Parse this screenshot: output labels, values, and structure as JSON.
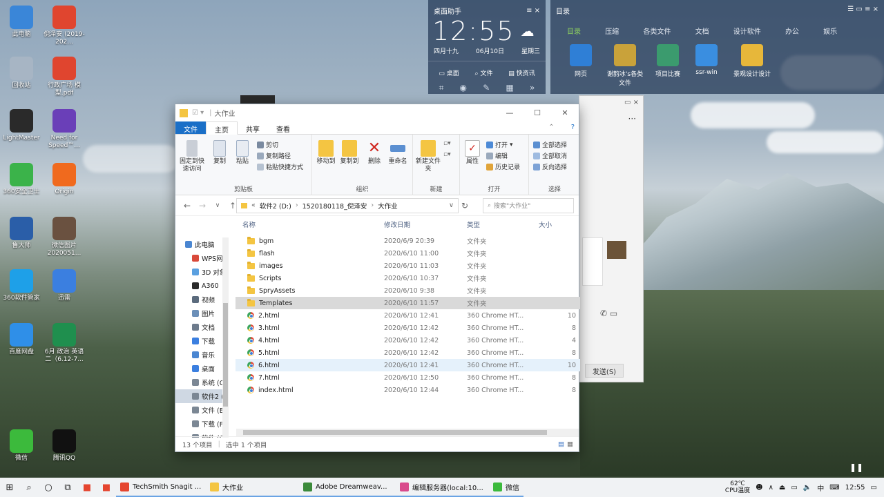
{
  "desktop_icons": [
    {
      "label": "此电脑",
      "icon": "computer-icon",
      "color": "#3a86d8"
    },
    {
      "label": "倪泽安 (2019-202...",
      "icon": "pdf-icon",
      "color": "#e0452f"
    },
    {
      "label": "回收站",
      "icon": "recycle-bin-icon",
      "color": "#a7b5c4"
    },
    {
      "label": "行政广场 模型.pdf",
      "icon": "pdf-icon",
      "color": "#e0452f"
    },
    {
      "label": "LightMaster",
      "icon": "lightmaster-icon",
      "color": "#2a2a2a"
    },
    {
      "label": "Need for Speed™...",
      "icon": "game-icon",
      "color": "#6a3fb8"
    },
    {
      "label": "360安全卫士",
      "icon": "360-security-icon",
      "color": "#3bb34a"
    },
    {
      "label": "Origin",
      "icon": "origin-icon",
      "color": "#f06a1e"
    },
    {
      "label": "鲁大师",
      "icon": "ludashi-icon",
      "color": "#2a5ea8"
    },
    {
      "label": "微信图片 2020051...",
      "icon": "image-icon",
      "color": "#6a5140"
    },
    {
      "label": "360软件管家",
      "icon": "360-software-icon",
      "color": "#1ea0e8"
    },
    {
      "label": "迅雷",
      "icon": "thunder-icon",
      "color": "#3b7fe0"
    },
    {
      "label": "百度网盘",
      "icon": "baidu-pan-icon",
      "color": "#2f8fe8"
    },
    {
      "label": "6月 政治 英语 二（6.12-7...",
      "icon": "excel-icon",
      "color": "#1f8f4e"
    },
    {
      "label": "微信",
      "icon": "wechat-icon",
      "color": "#3cba3c"
    },
    {
      "label": "腾讯QQ",
      "icon": "qq-icon",
      "color": "#111111"
    }
  ],
  "widget_clock": {
    "title": "桌面助手",
    "time": "12:55",
    "lunar": "四月十九",
    "date": "06月10日",
    "weekday": "星期三",
    "buttons": [
      "桌面",
      "文件",
      "快资讯"
    ]
  },
  "widget_dir": {
    "title": "目录",
    "tabs": [
      "目录",
      "压缩",
      "各类文件",
      "文档",
      "设计软件",
      "办公",
      "娱乐"
    ],
    "apps": [
      {
        "label": "网页",
        "color": "#2f7fd6"
      },
      {
        "label": "谢韵冰's各类文件",
        "color": "#c9a23a"
      },
      {
        "label": "项目比赛",
        "color": "#3b9b6e"
      },
      {
        "label": "ssr-win",
        "color": "#3a8ee0"
      },
      {
        "label": "景观设计设计",
        "color": "#e7b73a"
      }
    ]
  },
  "explorer": {
    "title": "大作业",
    "ribbon_tabs": [
      "文件",
      "主页",
      "共享",
      "查看"
    ],
    "groups": {
      "clipboard": "剪贴板",
      "organize": "组织",
      "new": "新建",
      "open": "打开",
      "select": "选择"
    },
    "buttons": {
      "pin": "固定到快速访问",
      "copy": "复制",
      "paste": "粘贴",
      "cut": "剪切",
      "copy_path": "复制路径",
      "paste_shortcut": "粘贴快捷方式",
      "move_to": "移动到",
      "copy_to": "复制到",
      "delete": "删除",
      "rename": "重命名",
      "new_folder": "新建文件夹",
      "properties": "属性",
      "open": "打开",
      "edit": "编辑",
      "history": "历史记录",
      "select_all": "全部选择",
      "select_none": "全部取消",
      "invert": "反向选择"
    },
    "address": [
      "软件2 (D:)",
      "1520180118_倪泽安",
      "大作业"
    ],
    "search_placeholder": "搜索\"大作业\"",
    "columns": [
      "名称",
      "修改日期",
      "类型",
      "大小"
    ],
    "nav_items": [
      "此电脑",
      "WPS网",
      "3D 对象",
      "A360",
      "视频",
      "图片",
      "文档",
      "下载",
      "音乐",
      "桌面",
      "系统 (C",
      "软件2 (D",
      "文件 (E",
      "下载 (F",
      "软件 (G"
    ],
    "files": [
      {
        "name": "bgm",
        "date": "2020/6/9 20:39",
        "type": "文件夹",
        "size": "",
        "kind": "folder"
      },
      {
        "name": "flash",
        "date": "2020/6/10 11:00",
        "type": "文件夹",
        "size": "",
        "kind": "folder"
      },
      {
        "name": "images",
        "date": "2020/6/10 11:03",
        "type": "文件夹",
        "size": "",
        "kind": "folder"
      },
      {
        "name": "Scripts",
        "date": "2020/6/10 10:37",
        "type": "文件夹",
        "size": "",
        "kind": "folder"
      },
      {
        "name": "SpryAssets",
        "date": "2020/6/10 9:38",
        "type": "文件夹",
        "size": "",
        "kind": "folder"
      },
      {
        "name": "Templates",
        "date": "2020/6/10 11:57",
        "type": "文件夹",
        "size": "",
        "kind": "folder"
      },
      {
        "name": "2.html",
        "date": "2020/6/10 12:41",
        "type": "360 Chrome HT...",
        "size": "10",
        "kind": "html"
      },
      {
        "name": "3.html",
        "date": "2020/6/10 12:42",
        "type": "360 Chrome HT...",
        "size": "8",
        "kind": "html"
      },
      {
        "name": "4.html",
        "date": "2020/6/10 12:42",
        "type": "360 Chrome HT...",
        "size": "4",
        "kind": "html"
      },
      {
        "name": "5.html",
        "date": "2020/6/10 12:42",
        "type": "360 Chrome HT...",
        "size": "8",
        "kind": "html"
      },
      {
        "name": "6.html",
        "date": "2020/6/10 12:41",
        "type": "360 Chrome HT...",
        "size": "10",
        "kind": "html"
      },
      {
        "name": "7.html",
        "date": "2020/6/10 12:50",
        "type": "360 Chrome HT...",
        "size": "8",
        "kind": "html"
      },
      {
        "name": "index.html",
        "date": "2020/6/10 12:44",
        "type": "360 Chrome HT...",
        "size": "8",
        "kind": "html"
      }
    ],
    "selected_index": 5,
    "hover_index": 10,
    "status_count": "13 个项目",
    "status_selected": "选中 1 个项目"
  },
  "chat": {
    "send": "发送(S)"
  },
  "taskbar": {
    "apps": [
      {
        "label": "TechSmith Snagit ...",
        "color": "#e5452f"
      },
      {
        "label": "大作业",
        "color": "#f4c542"
      },
      {
        "label": "Adobe Dreamweav...",
        "color": "#3b8a3a"
      },
      {
        "label": "编辑服务器(local:10...",
        "color": "#d94a8c"
      },
      {
        "label": "微信",
        "color": "#3cba3c"
      }
    ],
    "temp": "62℃",
    "temp_label": "CPU温度",
    "ime": "中",
    "time": "12:55"
  }
}
